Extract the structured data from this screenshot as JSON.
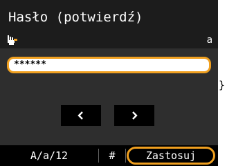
{
  "header": {
    "title": "Hasło (potwierdź)",
    "input_mode_icon": "hand-pointer-icon",
    "mode_indicator": "a"
  },
  "password_field": {
    "value": "******"
  },
  "navigation": {
    "prev_icon": "chevron-left-icon",
    "next_icon": "chevron-right-icon"
  },
  "footer": {
    "mode_switch_label": "A/a/12",
    "symbol_label": "#",
    "apply_label": "Zastosuj"
  },
  "outside_glyph": "}",
  "colors": {
    "accent": "#f0a020",
    "header_bg": "#1c1c1c",
    "body_bg": "#2e2e2e",
    "footer_bg": "#000000"
  }
}
